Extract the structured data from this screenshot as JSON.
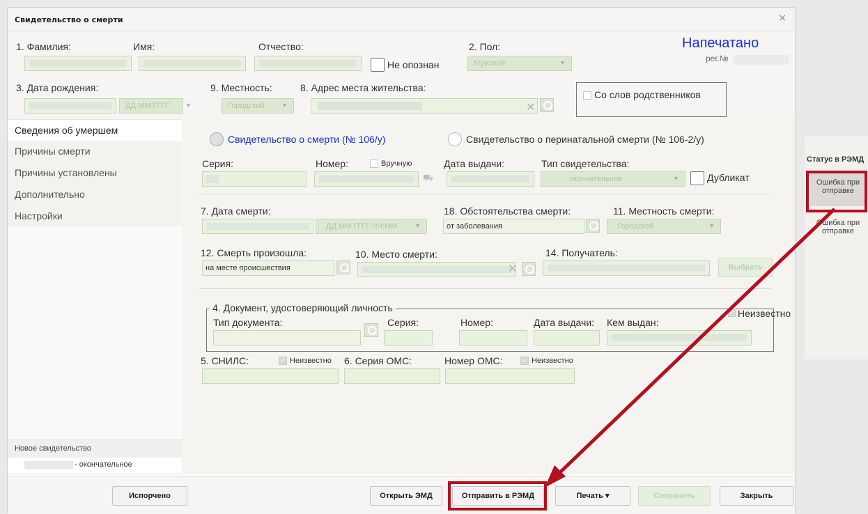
{
  "dialog": {
    "title": "Свидетельство о смерти",
    "close_glyph": "×"
  },
  "header": {
    "surname_label": "1. Фамилия:",
    "name_label": "Имя:",
    "patronymic_label": "Отчество:",
    "unidentified_label": "Не опознан",
    "sex_label": "2. Пол:",
    "sex_value": "Мужской",
    "status_printed": "Напечатано",
    "reg_label": "рег.№",
    "birthdate_label": "3. Дата рождения:",
    "birthdate_placeholder": "ДД.ММ.ГГГГ",
    "locality_label": "9. Местность:",
    "locality_value": "Городской",
    "address_label": "8. Адрес места жительства:",
    "relatives_label": "Со слов родственников"
  },
  "sidebar": {
    "items": [
      {
        "label": "Сведения об умершем"
      },
      {
        "label": "Причины смерти"
      },
      {
        "label": "Причины установлены"
      },
      {
        "label": "Дополнительно"
      },
      {
        "label": "Настройки"
      }
    ],
    "new_certificate": "Новое свидетельство",
    "type_suffix": "- окончательное"
  },
  "main": {
    "radio_106": "Свидетельство о смерти (№ 106/у)",
    "radio_106_2": "Свидетельство о перинатальной смерти (№ 106-2/у)",
    "series_label": "Серия:",
    "number_label": "Номер:",
    "manual_label": "Вручную",
    "issue_date_label": "Дата выдачи:",
    "cert_type_label": "Тип свидетельства:",
    "cert_type_value": "окончательное",
    "duplicate_label": "Дубликат",
    "death_date_label": "7. Дата смерти:",
    "death_date_placeholder": "ДД.ММ.ГГГГ ЧЧ:ММ",
    "circumstances_label": "18. Обстоятельства смерти:",
    "circumstances_value": "от заболевания",
    "death_locality_label": "11. Местность смерти:",
    "death_locality_value": "Городской",
    "death_occurred_label": "12. Смерть произошла:",
    "death_occurred_value": "на месте происшествия",
    "death_place_label": "10. Место смерти:",
    "recipient_label": "14. Получатель:",
    "choose_button": "Выбрать",
    "doc_legend": "4. Документ, удостоверяющий личность",
    "unknown_label": "Неизвестно",
    "doc_type_label": "Тип документа:",
    "doc_series_label": "Серия:",
    "doc_number_label": "Номер:",
    "doc_issue_label": "Дата выдачи:",
    "doc_issuer_label": "Кем выдан:",
    "snils_label": "5. СНИЛС:",
    "snils_unknown": "Неизвестно",
    "oms_series_label": "6. Серия ОМС:",
    "oms_number_label": "Номер ОМС:",
    "oms_unknown": "Неизвестно"
  },
  "footer": {
    "spoiled": "Испорчено",
    "open_emd": "Открыть ЭМД",
    "send_remd": "Отправить в РЭМД",
    "print": "Печать",
    "save": "Сохранить",
    "close": "Закрыть"
  },
  "right_panel": {
    "title": "Статус в РЭМД",
    "status_1": "Ошибка при отправке",
    "status_2": "Ошибка при отправке"
  },
  "colors": {
    "highlight": "#b5101e",
    "accent_blue": "#1a2fcc",
    "field_green": "#e8f2de"
  }
}
